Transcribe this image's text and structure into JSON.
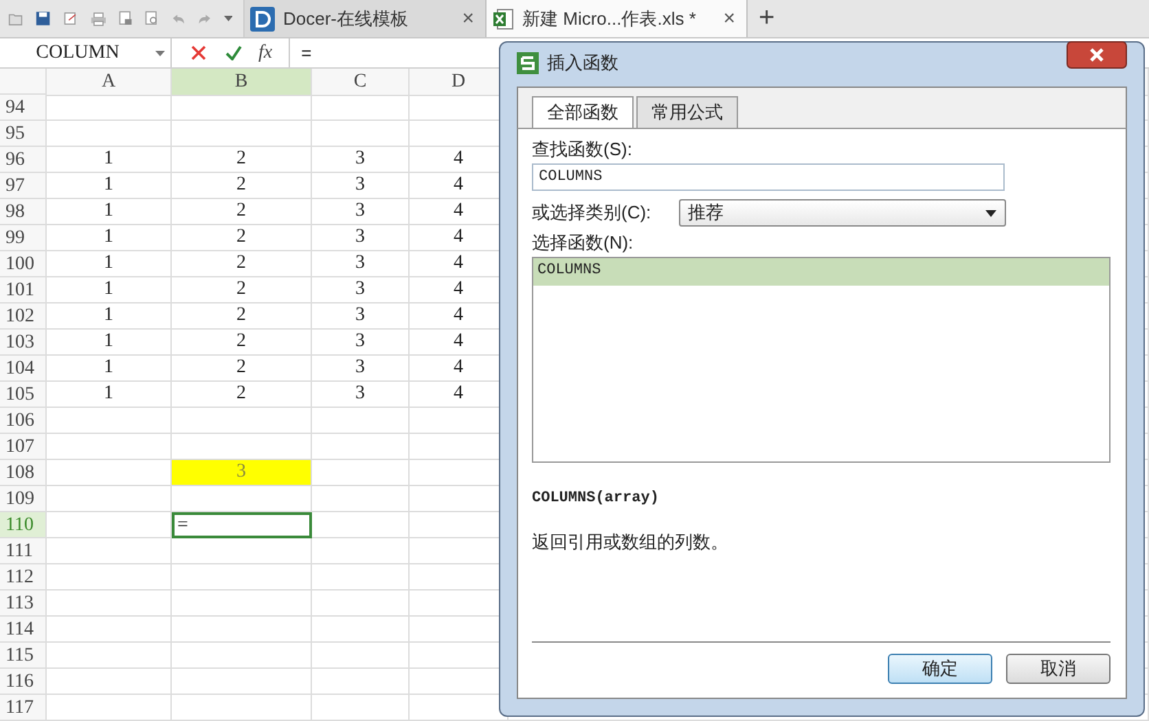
{
  "toolbar": {
    "tabs": [
      {
        "kind": "docer",
        "label": "Docer-在线模板",
        "close": "×",
        "selected": false
      },
      {
        "kind": "sheet",
        "label": "新建 Micro...作表.xls *",
        "close": "×",
        "selected": true
      }
    ],
    "new_tab": "+"
  },
  "formula_bar": {
    "name_box": "COLUMN",
    "fx": "fx",
    "value": "="
  },
  "sheet": {
    "columns": [
      {
        "label": "A",
        "selected": false
      },
      {
        "label": "B",
        "selected": true
      },
      {
        "label": "C",
        "selected": false
      },
      {
        "label": "D",
        "selected": false
      }
    ],
    "rows": [
      {
        "label": "94",
        "selected": false
      },
      {
        "label": "95",
        "selected": false
      },
      {
        "label": "96",
        "selected": false,
        "cells": [
          {
            "text": "1"
          },
          {
            "text": "2"
          },
          {
            "text": "3"
          },
          {
            "text": "4"
          }
        ]
      },
      {
        "label": "97",
        "selected": false,
        "cells": [
          {
            "text": "1"
          },
          {
            "text": "2"
          },
          {
            "text": "3"
          },
          {
            "text": "4"
          }
        ]
      },
      {
        "label": "98",
        "selected": false,
        "cells": [
          {
            "text": "1"
          },
          {
            "text": "2"
          },
          {
            "text": "3"
          },
          {
            "text": "4"
          }
        ]
      },
      {
        "label": "99",
        "selected": false,
        "cells": [
          {
            "text": "1"
          },
          {
            "text": "2"
          },
          {
            "text": "3"
          },
          {
            "text": "4"
          }
        ]
      },
      {
        "label": "100",
        "selected": false,
        "cells": [
          {
            "text": "1"
          },
          {
            "text": "2"
          },
          {
            "text": "3"
          },
          {
            "text": "4"
          }
        ]
      },
      {
        "label": "101",
        "selected": false,
        "cells": [
          {
            "text": "1"
          },
          {
            "text": "2"
          },
          {
            "text": "3"
          },
          {
            "text": "4"
          }
        ]
      },
      {
        "label": "102",
        "selected": false,
        "cells": [
          {
            "text": "1"
          },
          {
            "text": "2"
          },
          {
            "text": "3"
          },
          {
            "text": "4"
          }
        ]
      },
      {
        "label": "103",
        "selected": false,
        "cells": [
          {
            "text": "1"
          },
          {
            "text": "2"
          },
          {
            "text": "3"
          },
          {
            "text": "4"
          }
        ]
      },
      {
        "label": "104",
        "selected": false,
        "cells": [
          {
            "text": "1"
          },
          {
            "text": "2"
          },
          {
            "text": "3"
          },
          {
            "text": "4"
          }
        ]
      },
      {
        "label": "105",
        "selected": false,
        "cells": [
          {
            "text": "1"
          },
          {
            "text": "2"
          },
          {
            "text": "3"
          },
          {
            "text": "4"
          }
        ]
      },
      {
        "label": "106",
        "selected": false
      },
      {
        "label": "107",
        "selected": false
      },
      {
        "label": "108",
        "selected": false,
        "cells": [
          {},
          {
            "text": "3",
            "highlighted": true
          },
          {},
          {}
        ]
      },
      {
        "label": "109",
        "selected": false
      },
      {
        "label": "110",
        "selected": true,
        "cells": [
          {},
          {
            "text": "=",
            "active": true
          },
          {},
          {}
        ]
      },
      {
        "label": "111",
        "selected": false
      },
      {
        "label": "112",
        "selected": false
      },
      {
        "label": "113",
        "selected": false
      },
      {
        "label": "114",
        "selected": false
      },
      {
        "label": "115",
        "selected": false
      },
      {
        "label": "116",
        "selected": false
      },
      {
        "label": "117",
        "selected": false
      }
    ]
  },
  "dialog": {
    "title": "插入函数",
    "tabs": [
      {
        "label": "全部函数",
        "selected": true
      },
      {
        "label": "常用公式",
        "selected": false
      }
    ],
    "search_label": "查找函数(S):",
    "search_value": "COLUMNS",
    "category_label": "或选择类别(C):",
    "category_value": "推荐",
    "function_label": "选择函数(N):",
    "functions": [
      {
        "label": "COLUMNS",
        "selected": true
      }
    ],
    "syntax": "COLUMNS(array)",
    "description": "返回引用或数组的列数。",
    "buttons": [
      {
        "label": "确定",
        "default": true
      },
      {
        "label": "取消",
        "default": false
      }
    ]
  }
}
